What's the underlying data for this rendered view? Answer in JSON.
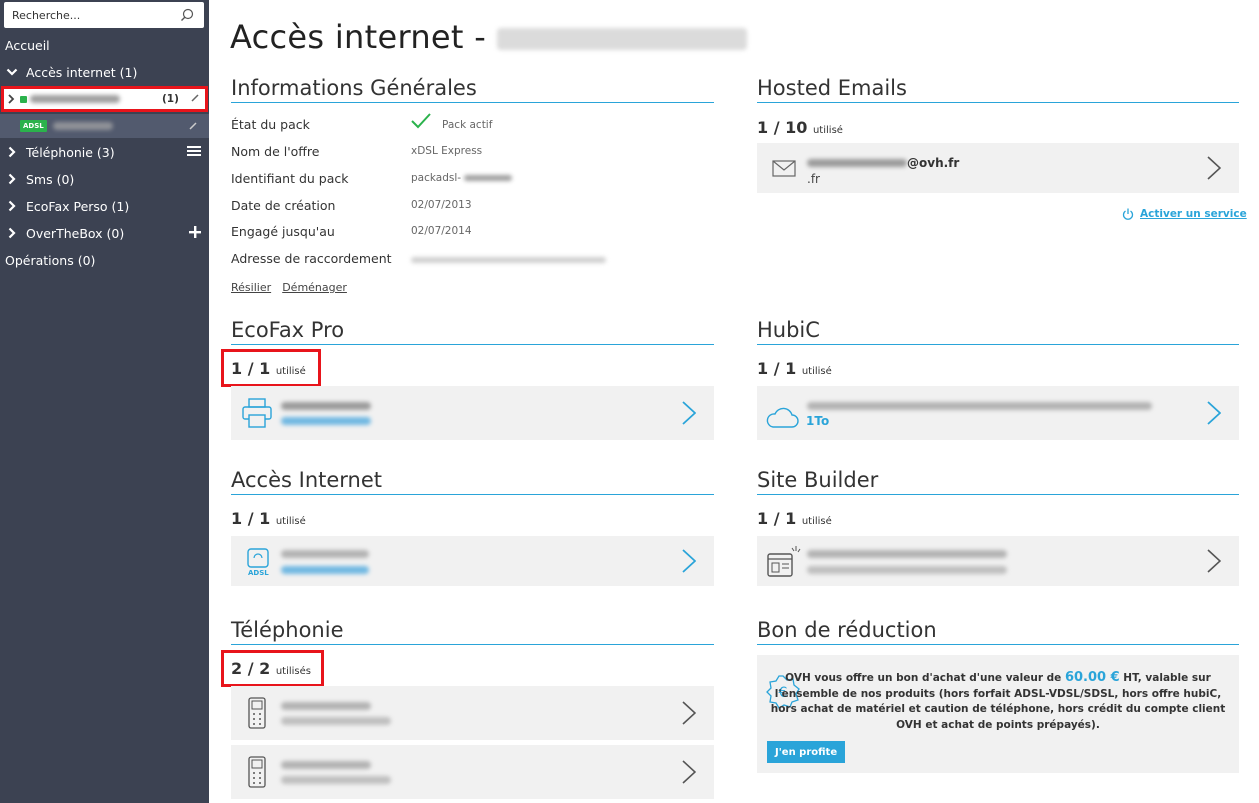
{
  "search": {
    "placeholder": "Recherche..."
  },
  "sidebar": {
    "home": "Accueil",
    "acces_internet": "Accès internet (1)",
    "pack_count": "(1)",
    "adsl_badge": "ADSL",
    "telephonie": "Téléphonie (3)",
    "sms": "Sms (0)",
    "ecofax": "EcoFax Perso (1)",
    "overthebox": "OverTheBox (0)",
    "operations": "Opérations (0)"
  },
  "page": {
    "title": "Accès internet -"
  },
  "general": {
    "title": "Informations Générales",
    "rows": [
      {
        "label": "État du pack",
        "value": "Pack actif"
      },
      {
        "label": "Nom de l'offre",
        "value": "xDSL Express"
      },
      {
        "label": "Identifiant du pack",
        "value": "packadsl-"
      },
      {
        "label": "Date de création",
        "value": "02/07/2013"
      },
      {
        "label": "Engagé jusqu'au",
        "value": "02/07/2014"
      },
      {
        "label": "Adresse de raccordement",
        "value": ""
      }
    ],
    "link_resilier": "Résilier",
    "link_demenager": "Déménager"
  },
  "hosted_emails": {
    "title": "Hosted Emails",
    "count": "1 / 10",
    "unit": "utilisé",
    "email_domain": "@ovh.fr",
    "email_tld": ".fr",
    "activate": "Activer un service"
  },
  "ecofax": {
    "title": "EcoFax Pro",
    "count": "1 / 1",
    "unit": "utilisé"
  },
  "hubic": {
    "title": "HubiC",
    "count": "1 / 1",
    "unit": "utilisé",
    "size": "1To"
  },
  "acces": {
    "title": "Accès Internet",
    "count": "1 / 1",
    "unit": "utilisé",
    "icon_label": "ADSL"
  },
  "site_builder": {
    "title": "Site Builder",
    "count": "1 / 1",
    "unit": "utilisé"
  },
  "telephonie": {
    "title": "Téléphonie",
    "count": "2 / 2",
    "unit": "utilisés"
  },
  "voucher": {
    "title": "Bon de réduction",
    "text_before": "OVH vous offre un bon d'achat d'une valeur de ",
    "amount": "60.00 €",
    "text_after": " HT, valable sur l'ensemble de nos produits (hors forfait ADSL-VDSL/SDSL, hors offre hubiC, hors achat de matériel et caution de téléphone, hors crédit du compte client OVH et achat de points prépayés).",
    "button": "J'en profite"
  },
  "colors": {
    "accent": "#2aa4d9",
    "sidebar": "#3c4252",
    "highlight": "#e8141b",
    "success": "#2bb24c"
  }
}
